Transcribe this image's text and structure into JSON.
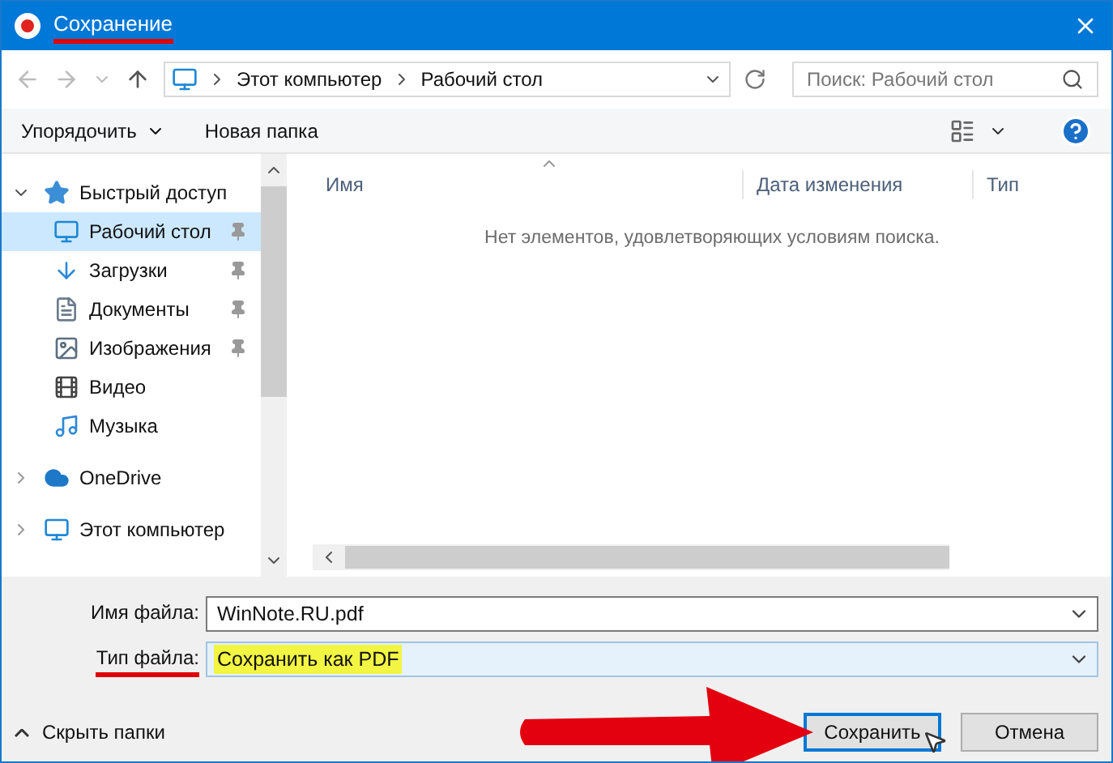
{
  "window": {
    "title": "Сохранение",
    "title_underlined": true
  },
  "address": {
    "path": [
      "Этот компьютер",
      "Рабочий стол"
    ]
  },
  "search": {
    "placeholder": "Поиск: Рабочий стол"
  },
  "toolbar": {
    "organize": "Упорядочить",
    "new_folder": "Новая папка"
  },
  "sidebar": {
    "items": [
      {
        "label": "Быстрый доступ",
        "kind": "star",
        "expanded": true,
        "children": [
          {
            "label": "Рабочий стол",
            "kind": "desktop",
            "pinned": true,
            "selected": true
          },
          {
            "label": "Загрузки",
            "kind": "download",
            "pinned": true,
            "selected": false
          },
          {
            "label": "Документы",
            "kind": "document",
            "pinned": true,
            "selected": false
          },
          {
            "label": "Изображения",
            "kind": "image",
            "pinned": true,
            "selected": false
          },
          {
            "label": "Видео",
            "kind": "video",
            "pinned": false,
            "selected": false
          },
          {
            "label": "Музыка",
            "kind": "music",
            "pinned": false,
            "selected": false
          }
        ]
      },
      {
        "label": "OneDrive",
        "kind": "cloud",
        "expanded": false
      },
      {
        "label": "Этот компьютер",
        "kind": "computer",
        "expanded": false
      }
    ]
  },
  "table": {
    "columns": [
      "Имя",
      "Дата изменения",
      "Тип"
    ],
    "empty_message": "Нет элементов, удовлетворяющих условиям поиска."
  },
  "file_name": {
    "label": "Имя файла:",
    "value": "WinNote.RU.pdf"
  },
  "file_type": {
    "label": "Тип файла:",
    "value": "Сохранить как PDF",
    "label_underlined": true,
    "highlighted": true
  },
  "hide_folders": "Скрыть папки",
  "buttons": [
    {
      "label": "Сохранить",
      "kind": "primary",
      "arrow": true
    },
    {
      "label": "Отмена",
      "kind": "secondary",
      "arrow": false
    }
  ]
}
